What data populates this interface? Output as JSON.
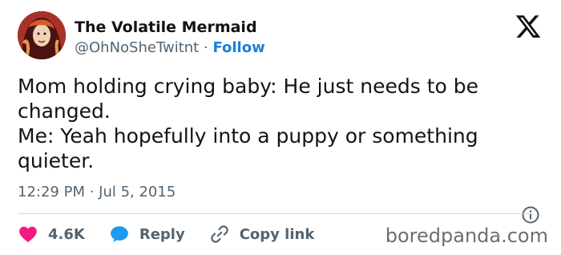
{
  "author": {
    "display_name": "The Volatile Mermaid",
    "handle": "@OhNoSheTwitnt",
    "separator": "·",
    "follow_label": "Follow"
  },
  "tweet": {
    "lines": [
      "Mom holding crying baby: He just needs to be",
      "changed.",
      "Me: Yeah hopefully into a puppy or something",
      "quieter."
    ],
    "timestamp": "12:29 PM · Jul 5, 2015"
  },
  "actions": {
    "like_count": "4.6K",
    "reply_label": "Reply",
    "copy_link_label": "Copy link"
  },
  "watermark": "boredpanda.com",
  "colors": {
    "like": "#f91880",
    "reply": "#1d9bf0",
    "follow": "#1d7fd6",
    "muted": "#536471"
  },
  "icons": {
    "brand": "x-logo-icon",
    "info": "info-icon",
    "like": "heart-icon",
    "reply": "speech-bubble-icon",
    "copy": "link-icon"
  }
}
